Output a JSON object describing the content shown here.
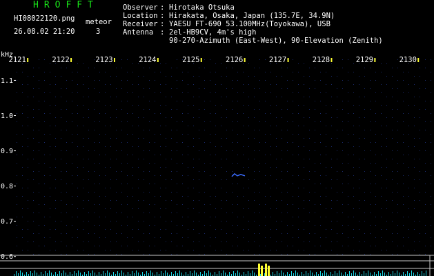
{
  "header": {
    "title": "HROFFT",
    "filename": "HI08022120.png",
    "datetime": "26.08.02 21:20",
    "meteor_label": "meteor",
    "meteor_count": "3"
  },
  "info": {
    "observer_key": "Observer",
    "observer_val": "Hirotaka Otsuka",
    "location_key": "Location",
    "location_val": "Hirakata, Osaka, Japan (135.7E, 34.9N)",
    "receiver_key": "Receiver",
    "receiver_val": "YAESU FT-690 53.100MHz(Toyokawa), USB",
    "antenna_key": "Antenna",
    "antenna_val": "2el-HB9CV, 4m's high",
    "antenna_val2": "90-270-Azimuth (East-West), 90-Elevation (Zenith)"
  },
  "colors": {
    "title": "#19e619",
    "text": "#ffffff",
    "grid": "#1a2a6a",
    "signal_blue": "#3a6cff",
    "signal_cyan": "#19d9e6",
    "signal_yellow": "#ffff33",
    "baseline": "#c8c8c8"
  },
  "chart_data": {
    "type": "heatmap",
    "y_unit": "kHz",
    "y_ticks": [
      "1.1",
      "1.0",
      "0.9",
      "0.8",
      "0.7",
      "0.6"
    ],
    "x_ticks": [
      "2121",
      "2122",
      "2123",
      "2124",
      "2125",
      "2126",
      "2127",
      "2128",
      "2129",
      "2130"
    ],
    "meteor_echo": {
      "x": 2126.1,
      "y": 0.83
    }
  }
}
